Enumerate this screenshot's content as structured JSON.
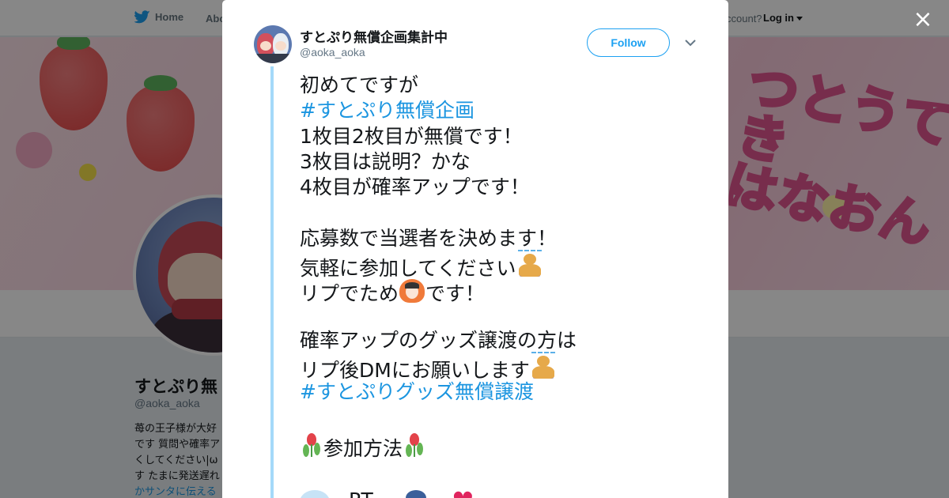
{
  "nav": {
    "home_label": "Home",
    "about_label": "Abo",
    "account_text": "ccount?",
    "login_label": "Log in"
  },
  "background_profile": {
    "banner_text_line1": "つとうてき",
    "banner_text_line2": "はなおん",
    "name": "すとぷり無",
    "handle": "@aoka_aoka",
    "bio_lines": [
      "苺の王子様が大好",
      "です 質問や確率ア",
      "くしてください|ω",
      "す たまに発送遅れ"
    ],
    "bio_link": "かサンタに伝える"
  },
  "modal": {
    "close_label": "×",
    "author_name": "すとぷり無償企画集計中",
    "author_handle": "@aoka_aoka",
    "follow_label": "Follow",
    "tweet": {
      "line1": "初めてですが",
      "hashtag1": "#すとぷり無償企画",
      "line3": "1枚目2枚目が無償です！",
      "line4": "3枚目は説明？かな",
      "line5": "4枚目が確率アップです！",
      "line6": "応募数で当選者を決めます！",
      "line7": "気軽に参加してください",
      "line8_a": "リプでため",
      "line8_b": "です！",
      "line9": "確率アップのグッズ譲渡の方は",
      "line10": "リプ後DMにお願いします",
      "hashtag2": "#すとぷりグッズ無償譲渡",
      "line12": "参加方法",
      "line13": "RT"
    }
  },
  "colors": {
    "accent": "#1da1f2",
    "hashtag": "#1b95e0",
    "thread_line": "#a4d9f9",
    "overlay": "rgba(0,0,0,0.47)"
  }
}
